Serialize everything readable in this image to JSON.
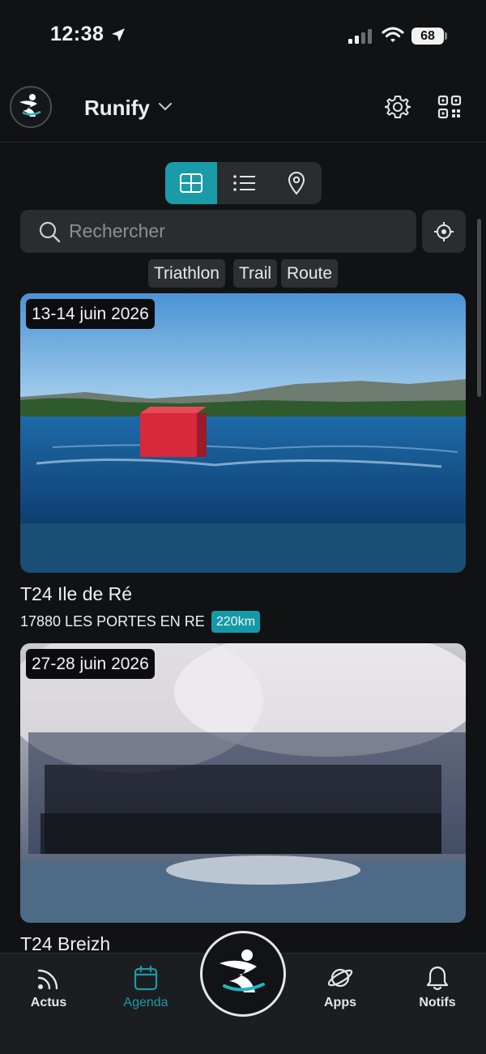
{
  "status_bar": {
    "time": "12:38",
    "battery": "68"
  },
  "header": {
    "title": "Runify"
  },
  "search": {
    "placeholder": "Rechercher"
  },
  "filters": [
    "Triathlon",
    "Trail",
    "Route"
  ],
  "events": [
    {
      "date": "13-14 juin 2026",
      "title": "T24 Ile de Ré",
      "location": "17880 LES PORTES EN RE",
      "distance": "220km"
    },
    {
      "date": "27-28 juin 2026",
      "title": "T24 Breizh"
    }
  ],
  "tabs": {
    "actus": "Actus",
    "agenda": "Agenda",
    "apps": "Apps",
    "notifs": "Notifs"
  },
  "colors": {
    "accent": "#1a9ba8",
    "background": "#111214"
  },
  "icons": [
    "location-arrow-icon",
    "signal-icon",
    "wifi-icon",
    "runify-logo",
    "chevron-down-icon",
    "gear-icon",
    "qr-code-icon",
    "grid-view-icon",
    "list-view-icon",
    "map-pin-icon",
    "search-icon",
    "locate-icon",
    "rss-icon",
    "calendar-icon",
    "planet-icon",
    "bell-icon"
  ]
}
